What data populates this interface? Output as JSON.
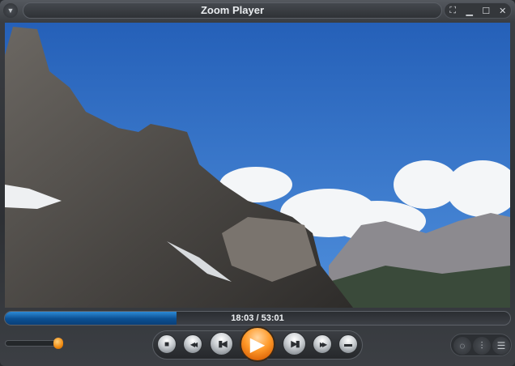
{
  "window": {
    "title": "Zoom Player"
  },
  "titlebar_buttons": [
    {
      "name": "fullscreen-icon",
      "glyph": "⛶"
    },
    {
      "name": "minimize-icon",
      "glyph": "▁"
    },
    {
      "name": "maximize-icon",
      "glyph": "☐"
    },
    {
      "name": "close-icon",
      "glyph": "✕"
    }
  ],
  "menu_glyph": "▼",
  "playback": {
    "time_display": "18:03 / 53:01",
    "progress": 0.34,
    "volume": 0.95
  },
  "controls": {
    "stop": "■",
    "rewind": "◀◀",
    "previous": "▮◀",
    "play": "▶",
    "next": "▶▮",
    "fast_forward": "▶▶",
    "open": "▬"
  },
  "right_controls": {
    "visualization": "◌",
    "equalizer": "⫶",
    "playlist": "☰"
  },
  "colors": {
    "accent": "#ff9a2a",
    "progress": "#0b5aa0"
  }
}
